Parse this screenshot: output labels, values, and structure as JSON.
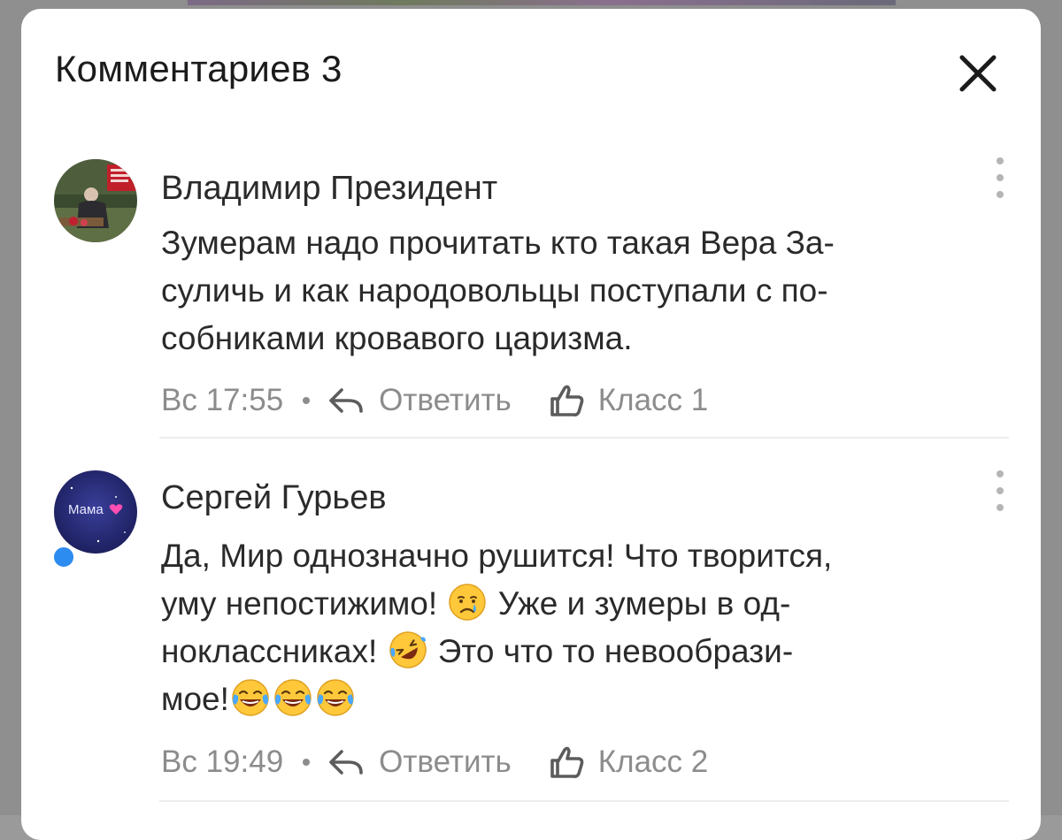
{
  "sheet": {
    "title": "Комментариев 3",
    "close_icon": "close-icon"
  },
  "comments": [
    {
      "author": "Владимир Президент",
      "avatar": "photo-avatar",
      "text_lines": [
        "Зумерам надо прочитать кто такая Вера За-",
        "суличь и как народовольцы поступали с по-",
        "собниками кровавого царизма."
      ],
      "time": "Вс 17:55",
      "reply_label": "Ответить",
      "like_label": "Класс 1"
    },
    {
      "author": "Сергей Гурьев",
      "avatar_label": "Мама",
      "online": true,
      "text_lines": [
        "Да, Мир однозначно рушится! Что творится,",
        "уму непостижимо! ",
        " Уже и зумеры в од-",
        "ноклассниках! ",
        " Это что то невообрази-",
        "мое!"
      ],
      "emojis": [
        "crying-face",
        "rolling-laughing-face",
        "tears-of-joy-face"
      ],
      "time": "Вс 19:49",
      "reply_label": "Ответить",
      "like_label": "Класс 2"
    }
  ],
  "colors": {
    "online": "#2d8cf0",
    "muted": "#8c8c8c"
  }
}
